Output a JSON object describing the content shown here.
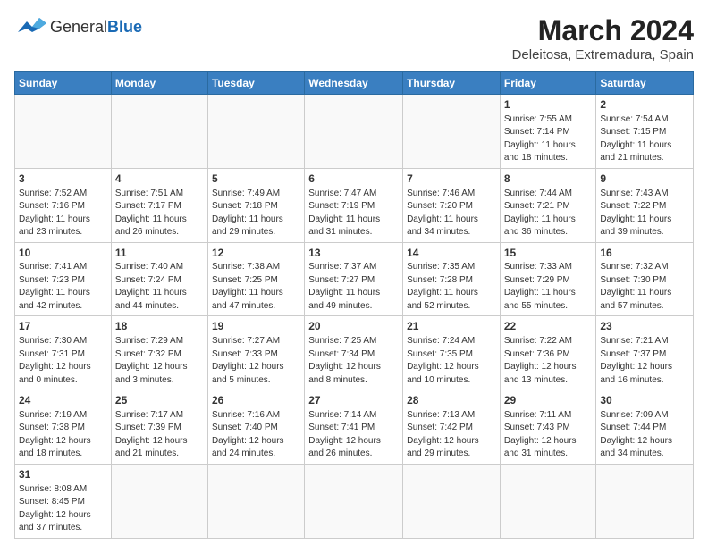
{
  "header": {
    "logo_text_general": "General",
    "logo_text_blue": "Blue",
    "title": "March 2024",
    "subtitle": "Deleitosa, Extremadura, Spain"
  },
  "days_of_week": [
    "Sunday",
    "Monday",
    "Tuesday",
    "Wednesday",
    "Thursday",
    "Friday",
    "Saturday"
  ],
  "weeks": [
    [
      {
        "day": "",
        "info": ""
      },
      {
        "day": "",
        "info": ""
      },
      {
        "day": "",
        "info": ""
      },
      {
        "day": "",
        "info": ""
      },
      {
        "day": "",
        "info": ""
      },
      {
        "day": "1",
        "info": "Sunrise: 7:55 AM\nSunset: 7:14 PM\nDaylight: 11 hours\nand 18 minutes."
      },
      {
        "day": "2",
        "info": "Sunrise: 7:54 AM\nSunset: 7:15 PM\nDaylight: 11 hours\nand 21 minutes."
      }
    ],
    [
      {
        "day": "3",
        "info": "Sunrise: 7:52 AM\nSunset: 7:16 PM\nDaylight: 11 hours\nand 23 minutes."
      },
      {
        "day": "4",
        "info": "Sunrise: 7:51 AM\nSunset: 7:17 PM\nDaylight: 11 hours\nand 26 minutes."
      },
      {
        "day": "5",
        "info": "Sunrise: 7:49 AM\nSunset: 7:18 PM\nDaylight: 11 hours\nand 29 minutes."
      },
      {
        "day": "6",
        "info": "Sunrise: 7:47 AM\nSunset: 7:19 PM\nDaylight: 11 hours\nand 31 minutes."
      },
      {
        "day": "7",
        "info": "Sunrise: 7:46 AM\nSunset: 7:20 PM\nDaylight: 11 hours\nand 34 minutes."
      },
      {
        "day": "8",
        "info": "Sunrise: 7:44 AM\nSunset: 7:21 PM\nDaylight: 11 hours\nand 36 minutes."
      },
      {
        "day": "9",
        "info": "Sunrise: 7:43 AM\nSunset: 7:22 PM\nDaylight: 11 hours\nand 39 minutes."
      }
    ],
    [
      {
        "day": "10",
        "info": "Sunrise: 7:41 AM\nSunset: 7:23 PM\nDaylight: 11 hours\nand 42 minutes."
      },
      {
        "day": "11",
        "info": "Sunrise: 7:40 AM\nSunset: 7:24 PM\nDaylight: 11 hours\nand 44 minutes."
      },
      {
        "day": "12",
        "info": "Sunrise: 7:38 AM\nSunset: 7:25 PM\nDaylight: 11 hours\nand 47 minutes."
      },
      {
        "day": "13",
        "info": "Sunrise: 7:37 AM\nSunset: 7:27 PM\nDaylight: 11 hours\nand 49 minutes."
      },
      {
        "day": "14",
        "info": "Sunrise: 7:35 AM\nSunset: 7:28 PM\nDaylight: 11 hours\nand 52 minutes."
      },
      {
        "day": "15",
        "info": "Sunrise: 7:33 AM\nSunset: 7:29 PM\nDaylight: 11 hours\nand 55 minutes."
      },
      {
        "day": "16",
        "info": "Sunrise: 7:32 AM\nSunset: 7:30 PM\nDaylight: 11 hours\nand 57 minutes."
      }
    ],
    [
      {
        "day": "17",
        "info": "Sunrise: 7:30 AM\nSunset: 7:31 PM\nDaylight: 12 hours\nand 0 minutes."
      },
      {
        "day": "18",
        "info": "Sunrise: 7:29 AM\nSunset: 7:32 PM\nDaylight: 12 hours\nand 3 minutes."
      },
      {
        "day": "19",
        "info": "Sunrise: 7:27 AM\nSunset: 7:33 PM\nDaylight: 12 hours\nand 5 minutes."
      },
      {
        "day": "20",
        "info": "Sunrise: 7:25 AM\nSunset: 7:34 PM\nDaylight: 12 hours\nand 8 minutes."
      },
      {
        "day": "21",
        "info": "Sunrise: 7:24 AM\nSunset: 7:35 PM\nDaylight: 12 hours\nand 10 minutes."
      },
      {
        "day": "22",
        "info": "Sunrise: 7:22 AM\nSunset: 7:36 PM\nDaylight: 12 hours\nand 13 minutes."
      },
      {
        "day": "23",
        "info": "Sunrise: 7:21 AM\nSunset: 7:37 PM\nDaylight: 12 hours\nand 16 minutes."
      }
    ],
    [
      {
        "day": "24",
        "info": "Sunrise: 7:19 AM\nSunset: 7:38 PM\nDaylight: 12 hours\nand 18 minutes."
      },
      {
        "day": "25",
        "info": "Sunrise: 7:17 AM\nSunset: 7:39 PM\nDaylight: 12 hours\nand 21 minutes."
      },
      {
        "day": "26",
        "info": "Sunrise: 7:16 AM\nSunset: 7:40 PM\nDaylight: 12 hours\nand 24 minutes."
      },
      {
        "day": "27",
        "info": "Sunrise: 7:14 AM\nSunset: 7:41 PM\nDaylight: 12 hours\nand 26 minutes."
      },
      {
        "day": "28",
        "info": "Sunrise: 7:13 AM\nSunset: 7:42 PM\nDaylight: 12 hours\nand 29 minutes."
      },
      {
        "day": "29",
        "info": "Sunrise: 7:11 AM\nSunset: 7:43 PM\nDaylight: 12 hours\nand 31 minutes."
      },
      {
        "day": "30",
        "info": "Sunrise: 7:09 AM\nSunset: 7:44 PM\nDaylight: 12 hours\nand 34 minutes."
      }
    ],
    [
      {
        "day": "31",
        "info": "Sunrise: 8:08 AM\nSunset: 8:45 PM\nDaylight: 12 hours\nand 37 minutes."
      },
      {
        "day": "",
        "info": ""
      },
      {
        "day": "",
        "info": ""
      },
      {
        "day": "",
        "info": ""
      },
      {
        "day": "",
        "info": ""
      },
      {
        "day": "",
        "info": ""
      },
      {
        "day": "",
        "info": ""
      }
    ]
  ]
}
